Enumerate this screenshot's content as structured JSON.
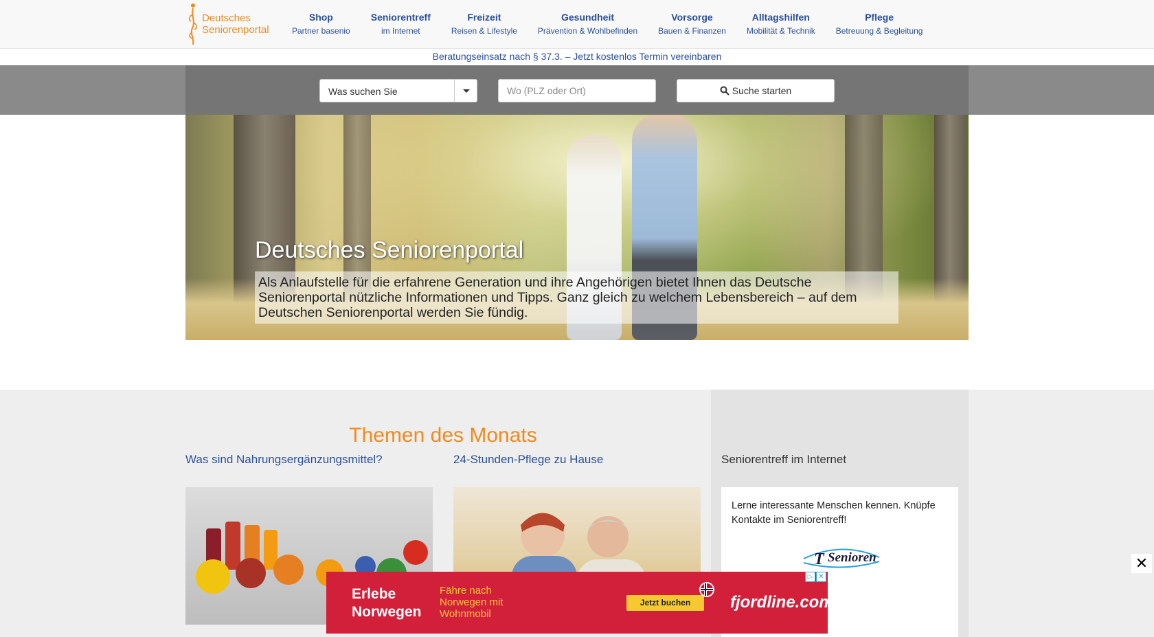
{
  "logo": {
    "line1": "Deutsches",
    "line2": "Seniorenportal"
  },
  "nav": [
    {
      "title": "Shop",
      "sub": "Partner basenio"
    },
    {
      "title": "Seniorentreff",
      "sub": "im Internet"
    },
    {
      "title": "Freizeit",
      "sub": "Reisen & Lifestyle"
    },
    {
      "title": "Gesundheit",
      "sub": "Prävention & Wohlbefinden"
    },
    {
      "title": "Vorsorge",
      "sub": "Bauen & Finanzen"
    },
    {
      "title": "Alltagshilfen",
      "sub": "Mobilität & Technik"
    },
    {
      "title": "Pflege",
      "sub": "Betreuung & Begleitung"
    }
  ],
  "notice": "Beratungseinsatz nach § 37.3. – Jetzt kostenlos Termin vereinbaren",
  "search": {
    "category_label": "Was suchen Sie",
    "location_placeholder": "Wo (PLZ oder Ort)",
    "button_label": "Suche starten"
  },
  "hero": {
    "title": "Deutsches Seniorenportal",
    "description": "Als Anlaufstelle für die erfahrene Generation und ihre Angehörigen bietet Ihnen das Deutsche Seniorenportal nützliche Informationen und Tipps. Ganz gleich zu welchem Lebensbereich – auf dem Deutschen Seniorenportal werden Sie fündig."
  },
  "themen": {
    "heading": "Themen des Monats",
    "articles": [
      {
        "title": "Was sind Nahrungsergänzungsmittel?"
      },
      {
        "title": "24-Stunden-Pflege zu Hause"
      }
    ]
  },
  "sidebar": {
    "title": "Seniorentreff im Internet",
    "text": "Lerne interessante Menschen kennen. Knüpfe Kontakte im Seniorentreff!",
    "logo_text": "Senioren"
  },
  "ad": {
    "headline_1": "Erlebe",
    "headline_2": "Norwegen",
    "sub_1": "Fähre nach",
    "sub_2": "Norwegen mit",
    "sub_3": "Wohnmobil",
    "button": "Jetzt buchen",
    "brand": "fjordline.com"
  },
  "close_icon": "close-icon",
  "colors": {
    "brand_orange": "#f08a1d",
    "nav_blue": "#2a4f9a",
    "ad_red": "#d2203b",
    "ad_yellow": "#f6c933"
  }
}
